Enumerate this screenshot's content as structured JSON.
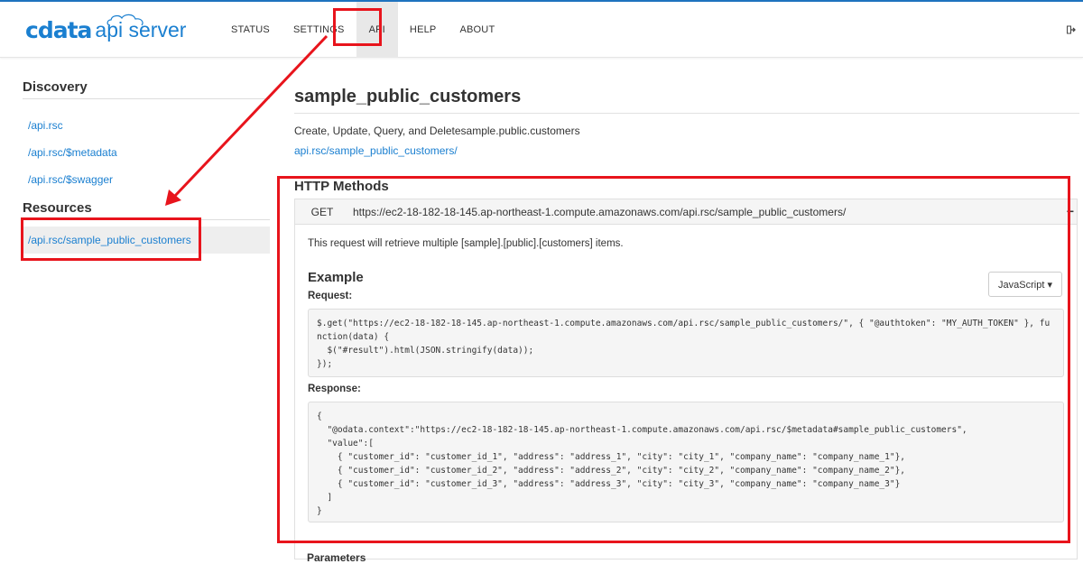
{
  "brand": {
    "name": "cdata",
    "product": "api server"
  },
  "nav": {
    "items": [
      {
        "label": "STATUS",
        "active": false
      },
      {
        "label": "SETTINGS",
        "active": false
      },
      {
        "label": "API",
        "active": true
      },
      {
        "label": "HELP",
        "active": false
      },
      {
        "label": "ABOUT",
        "active": false
      }
    ],
    "logout_icon": "sign-out-icon"
  },
  "sidebar": {
    "discovery_heading": "Discovery",
    "discovery_links": [
      "/api.rsc",
      "/api.rsc/$metadata",
      "/api.rsc/$swagger"
    ],
    "resources_heading": "Resources",
    "resource_links": [
      "/api.rsc/sample_public_customers"
    ]
  },
  "main": {
    "title": "sample_public_customers",
    "description": "Create, Update, Query, and Deletesample.public.customers",
    "resource_link": "api.rsc/sample_public_customers/",
    "http_methods_heading": "HTTP Methods",
    "method": {
      "verb": "GET",
      "url": "https://ec2-18-182-18-145.ap-northeast-1.compute.amazonaws.com/api.rsc/sample_public_customers/",
      "collapse_symbol": "−",
      "description": "This request will retrieve multiple [sample].[public].[customers] items.",
      "language_button": "JavaScript ▾",
      "example_heading": "Example",
      "request_label": "Request:",
      "request_code": "$.get(\"https://ec2-18-182-18-145.ap-northeast-1.compute.amazonaws.com/api.rsc/sample_public_customers/\", { \"@authtoken\": \"MY_AUTH_TOKEN\" }, fu\nnction(data) {\n  $(\"#result\").html(JSON.stringify(data));\n});",
      "response_label": "Response:",
      "response_code": "{\n  \"@odata.context\":\"https://ec2-18-182-18-145.ap-northeast-1.compute.amazonaws.com/api.rsc/$metadata#sample_public_customers\",\n  \"value\":[\n    { \"customer_id\": \"customer_id_1\", \"address\": \"address_1\", \"city\": \"city_1\", \"company_name\": \"company_name_1\"},\n    { \"customer_id\": \"customer_id_2\", \"address\": \"address_2\", \"city\": \"city_2\", \"company_name\": \"company_name_2\"},\n    { \"customer_id\": \"customer_id_3\", \"address\": \"address_3\", \"city\": \"city_3\", \"company_name\": \"company_name_3\"}\n  ]\n}"
    },
    "next_section_label": "Parameters"
  },
  "colors": {
    "link": "#1a7fd0",
    "highlight": "#e8141c",
    "top_border": "#1e73be"
  }
}
